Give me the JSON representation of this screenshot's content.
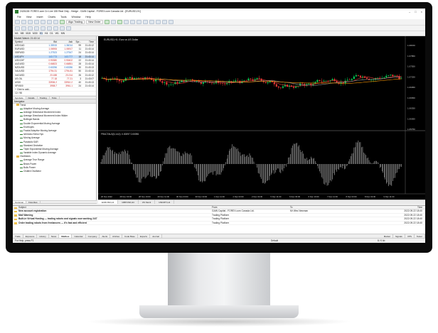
{
  "window": {
    "title": "2426138: FOREX.com Cn Live 155 Real Only - Hedge - GAIN Capital - FOREX.com Canada Ltd - [EURUSD,H1]",
    "controls": [
      "–",
      "□",
      "×"
    ]
  },
  "menu": [
    "File",
    "View",
    "Insert",
    "Charts",
    "Tools",
    "Window",
    "Help"
  ],
  "toolbar": {
    "algo_trading": "Algo Trading",
    "new_order": "New Order",
    "timeframes": [
      "M1",
      "M5",
      "M15",
      "M30",
      "H1",
      "H4",
      "D1",
      "W1",
      "MN"
    ]
  },
  "market_watch": {
    "title": "Market Watch: 21:43:14",
    "columns": [
      "Symbol",
      "Bid",
      "Ask",
      "Spr...",
      "Time"
    ],
    "rows": [
      {
        "symbol": "USDCAD",
        "bid": "1.35915",
        "ask": "1.36014",
        "spread": "99",
        "time": "21:43:12",
        "dir": "up"
      },
      {
        "symbol": "EURUSD",
        "bid": "1.06906",
        "ask": "1.06917",
        "spread": "11",
        "time": "21:43:14",
        "dir": "dn"
      },
      {
        "symbol": "GBPUSD",
        "bid": "1.27523",
        "ask": "1.27547",
        "spread": "24",
        "time": "21:43:14",
        "dir": "up"
      },
      {
        "symbol": "USDJPY",
        "bid": "143.773",
        "ask": "143.777",
        "spread": "18",
        "time": "21:43:14",
        "dir": "up",
        "selected": true
      },
      {
        "symbol": "USDCHF",
        "bid": "0.90380",
        "ask": "0.90402",
        "spread": "22",
        "time": "21:43:14",
        "dir": "dn"
      },
      {
        "symbol": "AUDUSD",
        "bid": "0.66823",
        "ask": "0.66851",
        "spread": "28",
        "time": "21:43:14",
        "dir": "dn"
      },
      {
        "symbol": "NZDUSD",
        "bid": "0.60256",
        "ask": "0.60286",
        "spread": "30",
        "time": "21:43:13",
        "dir": "up"
      },
      {
        "symbol": "XAUUSD",
        "bid": "1794.31",
        "ask": "1794.81",
        "spread": "50",
        "time": "21:43:14",
        "dir": "dn"
      },
      {
        "symbol": "XAGUSD",
        "bid": "23.188",
        "ask": "23.214",
        "spread": "26",
        "time": "21:43:12",
        "dir": "dn"
      },
      {
        "symbol": "US.OIL",
        "bid": "77.18",
        "ask": "77.21",
        "spread": "3",
        "time": "21:43:07",
        "dir": "dn"
      },
      {
        "symbol": "US30",
        "bid": "33906.2",
        "ask": "33910.2",
        "spread": "40",
        "time": "21:43:13",
        "dir": "dn"
      },
      {
        "symbol": "SPX500",
        "bid": "3958.7",
        "ask": "3961.1",
        "spread": "24",
        "time": "21:43:14",
        "dir": "dn"
      },
      {
        "symbol": "+ Click to add...",
        "bid": "",
        "ask": "",
        "spread": "",
        "time": "",
        "dir": "none"
      }
    ],
    "count_label": "12 / 98",
    "tabs": [
      "Symbols",
      "Details",
      "Trading",
      "Ticks"
    ]
  },
  "navigator": {
    "title": "Navigator",
    "items": [
      {
        "label": "Trend",
        "type": "folder",
        "indent": 1
      },
      {
        "label": "Adaptive Moving Average",
        "type": "ind",
        "indent": 2
      },
      {
        "label": "Average Directional Movement Index",
        "type": "ind",
        "indent": 2
      },
      {
        "label": "Average Directional Movement Index Wilder",
        "type": "ind",
        "indent": 2
      },
      {
        "label": "Bollinger Bands",
        "type": "ind",
        "indent": 2
      },
      {
        "label": "Double Exponential Moving Average",
        "type": "ind",
        "indent": 2
      },
      {
        "label": "Envelopes",
        "type": "ind",
        "indent": 2
      },
      {
        "label": "Fractal Adaptive Moving Average",
        "type": "ind",
        "indent": 2
      },
      {
        "label": "Ichimoku Kinko Hyo",
        "type": "ind",
        "indent": 2
      },
      {
        "label": "Moving Average",
        "type": "ind",
        "indent": 2
      },
      {
        "label": "Parabolic SAR",
        "type": "ind",
        "indent": 2
      },
      {
        "label": "Standard Deviation",
        "type": "ind",
        "indent": 2
      },
      {
        "label": "Triple Exponential Moving Average",
        "type": "ind",
        "indent": 2
      },
      {
        "label": "Variable Index Dynamic Average",
        "type": "ind",
        "indent": 2
      },
      {
        "label": "Oscillators",
        "type": "folder",
        "indent": 1
      },
      {
        "label": "Average True Range",
        "type": "ind",
        "indent": 2
      },
      {
        "label": "Bears Power",
        "type": "ind",
        "indent": 2
      },
      {
        "label": "Bulls Power",
        "type": "ind",
        "indent": 2
      },
      {
        "label": "Chaikin Oscillator",
        "type": "ind",
        "indent": 2
      }
    ],
    "tabs": [
      "Common",
      "Favorites"
    ]
  },
  "chart": {
    "symbol_label": "EURUSD,H1: Euro vs US Dollar",
    "osc_label": "FRACTALS(5,14,0): 0.00097 0.00096",
    "price_axis": [
      "1.08150",
      "1.07850",
      "1.07550",
      "1.07250",
      "1.06950",
      "1.06650",
      "1.06350",
      "1.06050",
      "1.05750"
    ],
    "time_axis": [
      "26 Nov 2022",
      "28 Nov 03:00",
      "28 Nov 19:00",
      "29 Nov 11:00",
      "30 Nov 03:00",
      "30 Nov 19:00",
      "1 Dec 11:00",
      "2 Dec 03:00",
      "2 Dec 19:00",
      "5 Dec 11:00",
      "6 Dec 03:00",
      "6 Dec 19:00",
      "7 Dec 11:00",
      "8 Dec 03:00",
      "8 Dec 19:00",
      "9 Dec 11:00"
    ],
    "tabs": [
      "EURUSD,H1",
      "GBPUSD,H4",
      "US Stock",
      "USDJPY,H1"
    ],
    "bull_color": "#00c853",
    "bear_color": "#e53935"
  },
  "terminal": {
    "columns": [
      "Subject",
      "From",
      "To",
      "Time"
    ],
    "messages": [
      {
        "subject": "New account registration",
        "from": "GAIN Capital - FOREX.com Canada Ltd.",
        "to": "Mr Wes Newman",
        "time": "2022.09.22 18:40"
      },
      {
        "subject": "Mail Warning",
        "from": "Trading Platform",
        "to": "",
        "time": "2022.09.22 18:40"
      },
      {
        "subject": "Built-in Virtual Hosting — trading robots and signals now working 24/7",
        "from": "Trading Platform",
        "to": "",
        "time": "2022.09.22 18:40"
      },
      {
        "subject": "Order trading robots from freelancers — it's fast and efficient",
        "from": "Trading Platform",
        "to": "",
        "time": "2022.09.22 18:40"
      }
    ],
    "tabs": [
      "Trade",
      "Exposure",
      "History",
      "News",
      "Mailbox",
      "Calendar",
      "Company",
      "Alerts",
      "Articles",
      "Code Base",
      "Experts",
      "Journal"
    ],
    "active_tab": "Mailbox",
    "right_tabs": [
      "Market",
      "Signals",
      "VPS",
      "Tester"
    ]
  },
  "status": {
    "help": "For Help, press F1",
    "profile": "Default",
    "ping": "8 / 0 kb"
  }
}
